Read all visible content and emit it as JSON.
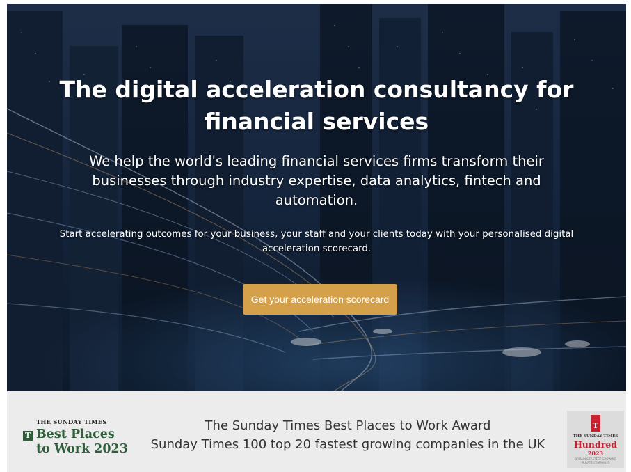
{
  "hero": {
    "headline": "The digital acceleration consultancy for financial services",
    "subheading": "We help the world's leading financial services firms transform their businesses through industry expertise, data analytics, fintech and automation.",
    "intro": "Start accelerating outcomes for your business, your staff and your clients today with your personalised digital acceleration scorecard.",
    "cta_label": "Get your acceleration scorecard",
    "cta_color": "#d4a04a"
  },
  "awards": {
    "best_places_logo": {
      "publisher": "THE SUNDAY TIMES",
      "mark": "T",
      "line1": "Best Places",
      "line2": "to Work 2023",
      "color": "#2e5f3a"
    },
    "award_lines": [
      "The Sunday Times Best Places to Work Award",
      "Sunday Times 100 top 20 fastest growing companies in the UK"
    ],
    "hundred_logo": {
      "mark": "T",
      "publisher": "THE SUNDAY TIMES",
      "title": "Hundred",
      "year": "2023",
      "tagline": "BRITAIN'S FASTEST GROWING PRIVATE COMPANIES",
      "color": "#c8202f"
    }
  }
}
